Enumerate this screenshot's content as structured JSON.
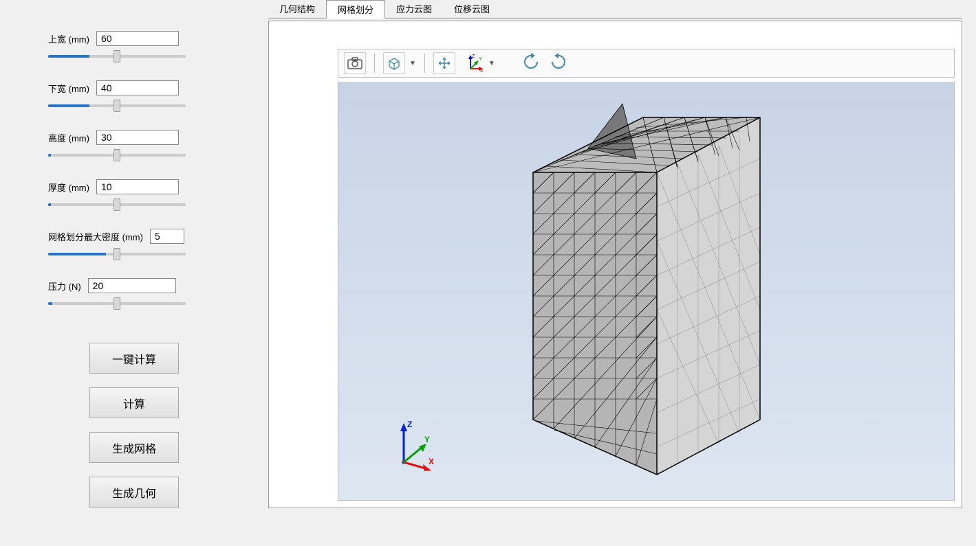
{
  "params": {
    "top_width": {
      "label": "上宽 (mm)",
      "value": "60",
      "pct": 30
    },
    "bottom_width": {
      "label": "下宽 (mm)",
      "value": "40",
      "pct": 30
    },
    "height": {
      "label": "高度 (mm)",
      "value": "30",
      "pct": 2
    },
    "thickness": {
      "label": "厚度 (mm)",
      "value": "10",
      "pct": 2
    },
    "mesh_density": {
      "label": "网格划分最大密度 (mm)",
      "value": "5",
      "pct": 42
    },
    "pressure": {
      "label": "压力 (N)",
      "value": "20",
      "pct": 3
    }
  },
  "buttons": {
    "one_click": "一键计算",
    "compute": "计算",
    "gen_mesh": "生成网格",
    "gen_geom": "生成几何"
  },
  "tabs": {
    "geom": "几何结构",
    "mesh": "网格划分",
    "stress": "应力云图",
    "disp": "位移云图"
  },
  "triad": {
    "x": "X",
    "y": "Y",
    "z": "Z"
  },
  "toolbar": {
    "camera": "camera-icon",
    "cube": "cube-view-icon",
    "move": "pan-icon",
    "axes": "axes-icon",
    "rot_cw": "rotate-cw-icon",
    "rot_ccw": "rotate-ccw-icon"
  }
}
